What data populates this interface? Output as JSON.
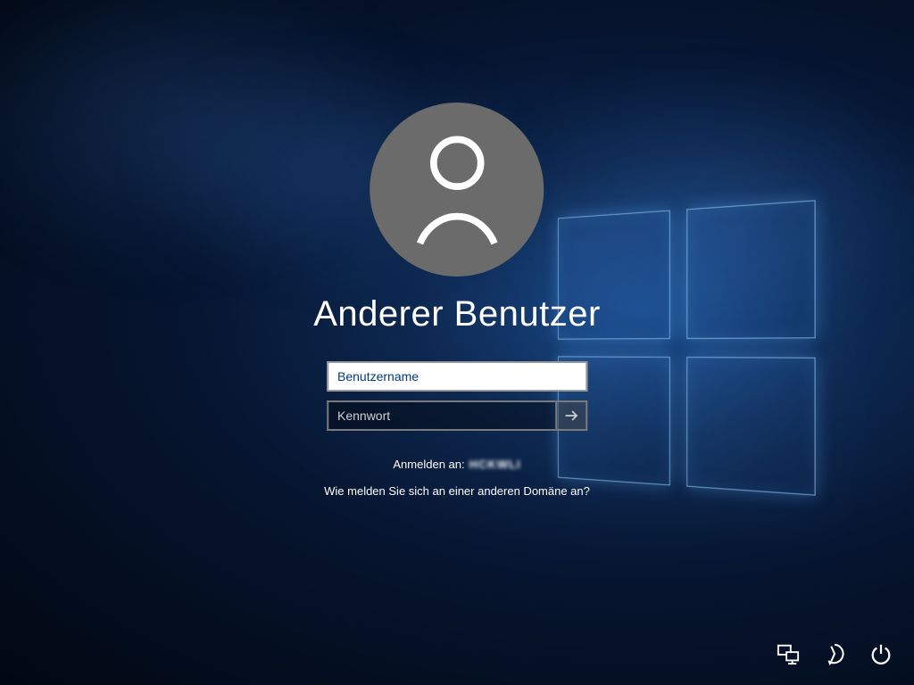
{
  "title": "Anderer Benutzer",
  "username": {
    "placeholder": "Benutzername",
    "value": ""
  },
  "password": {
    "placeholder": "Kennwort",
    "value": ""
  },
  "signin": {
    "label": "Anmelden an:",
    "domain": "HCKWLI"
  },
  "domain_help": "Wie melden Sie sich an einer anderen Domäne an?",
  "icons": {
    "avatar": "user-icon",
    "submit": "arrow-right-icon",
    "network": "network-icon",
    "ease": "ease-of-access-icon",
    "power": "power-icon"
  }
}
